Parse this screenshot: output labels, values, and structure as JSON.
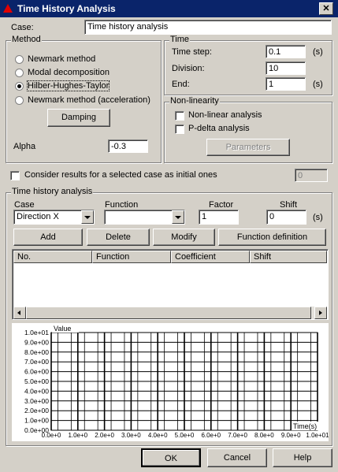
{
  "window": {
    "title": "Time History Analysis",
    "close_glyph": "✕"
  },
  "case": {
    "label": "Case:",
    "value": "Time history analysis"
  },
  "method": {
    "legend": "Method",
    "options": [
      "Newmark method",
      "Modal decomposition",
      "Hilber-Hughes-Taylor",
      "Newmark method (acceleration)"
    ],
    "selected": "Hilber-Hughes-Taylor",
    "damping_button": "Damping",
    "alpha_label": "Alpha",
    "alpha_value": "-0.3"
  },
  "time": {
    "legend": "Time",
    "step_label": "Time step:",
    "step_value": "0.1",
    "step_unit": "(s)",
    "division_label": "Division:",
    "division_value": "10",
    "end_label": "End:",
    "end_value": "1",
    "end_unit": "(s)"
  },
  "nonlinearity": {
    "legend": "Non-linearity",
    "nonlinear_label": "Non-linear analysis",
    "pdelta_label": "P-delta analysis",
    "parameters_button": "Parameters"
  },
  "initial": {
    "label": "Consider results for a selected case as initial ones",
    "value": "0"
  },
  "tha": {
    "legend": "Time history analysis",
    "case_label": "Case",
    "case_value": "Direction X",
    "function_label": "Function",
    "function_value": "",
    "factor_label": "Factor",
    "factor_value": "1",
    "shift_label": "Shift",
    "shift_value": "0",
    "shift_unit": "(s)",
    "buttons": {
      "add": "Add",
      "delete": "Delete",
      "modify": "Modify",
      "function_definition": "Function definition"
    },
    "columns": [
      "No.",
      "Function",
      "Coefficient",
      "Shift"
    ]
  },
  "chart_data": {
    "type": "line",
    "ylabel": "Value",
    "xlabel": "Time(s)",
    "ylim": [
      0,
      10
    ],
    "xlim": [
      0,
      10
    ],
    "y_ticks": [
      "0.0e+00",
      "1.0e+00",
      "2.0e+00",
      "3.0e+00",
      "4.0e+00",
      "5.0e+00",
      "6.0e+00",
      "7.0e+00",
      "8.0e+00",
      "9.0e+00",
      "1.0e+01"
    ],
    "x_ticks": [
      "0.0e+0",
      "1.0e+0",
      "2.0e+0",
      "3.0e+0",
      "4.0e+0",
      "5.0e+0",
      "6.0e+0",
      "7.0e+0",
      "8.0e+0",
      "9.0e+0",
      "1.0e+01"
    ],
    "grid": true,
    "series": []
  },
  "footer": {
    "ok": "OK",
    "cancel": "Cancel",
    "help": "Help"
  }
}
